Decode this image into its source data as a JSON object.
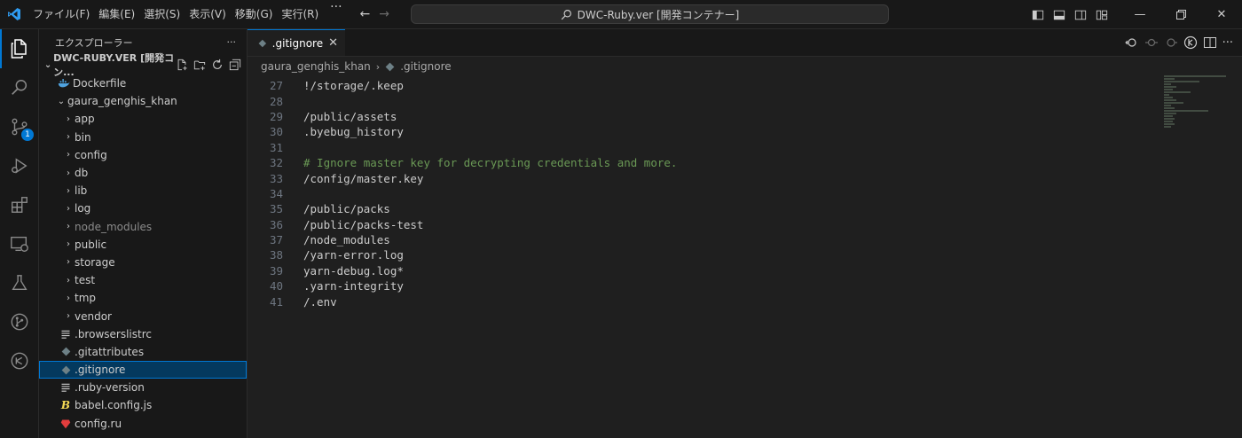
{
  "titlebar": {
    "menus": [
      "ファイル(F)",
      "編集(E)",
      "選択(S)",
      "表示(V)",
      "移動(G)",
      "実行(R)"
    ],
    "more": "···",
    "command_center": "DWC-Ruby.ver [開発コンテナー]"
  },
  "activitybar": {
    "scm_badge": "1",
    "items": [
      "explorer-icon",
      "search-icon",
      "source-control-icon",
      "run-debug-icon",
      "extensions-icon",
      "remote-explorer-icon",
      "testing-icon",
      "git-graph-icon",
      "docker-icon"
    ]
  },
  "sidebar": {
    "title": "エクスプローラー",
    "more": "···",
    "root": "DWC-RUBY.VER [開発コン...",
    "items": [
      {
        "label": "Dockerfile",
        "kind": "docker-file"
      },
      {
        "label": "gaura_genghis_khan",
        "kind": "folder-open"
      },
      {
        "label": "app",
        "kind": "folder"
      },
      {
        "label": "bin",
        "kind": "folder"
      },
      {
        "label": "config",
        "kind": "folder"
      },
      {
        "label": "db",
        "kind": "folder"
      },
      {
        "label": "lib",
        "kind": "folder"
      },
      {
        "label": "log",
        "kind": "folder"
      },
      {
        "label": "node_modules",
        "kind": "folder-dim"
      },
      {
        "label": "public",
        "kind": "folder"
      },
      {
        "label": "storage",
        "kind": "folder"
      },
      {
        "label": "test",
        "kind": "folder"
      },
      {
        "label": "tmp",
        "kind": "folder"
      },
      {
        "label": "vendor",
        "kind": "folder"
      },
      {
        "label": ".browserslistrc",
        "kind": "file-lines"
      },
      {
        "label": ".gitattributes",
        "kind": "git-file"
      },
      {
        "label": ".gitignore",
        "kind": "git-file"
      },
      {
        "label": ".ruby-version",
        "kind": "file-lines"
      },
      {
        "label": "babel.config.js",
        "kind": "babel-file"
      },
      {
        "label": "config.ru",
        "kind": "ruby-file"
      }
    ]
  },
  "editor": {
    "tab_label": ".gitignore",
    "breadcrumb": [
      "gaura_genghis_khan",
      ".gitignore"
    ],
    "lines": [
      {
        "n": "27",
        "text": "!/storage/.keep"
      },
      {
        "n": "28",
        "text": ""
      },
      {
        "n": "29",
        "text": "/public/assets"
      },
      {
        "n": "30",
        "text": ".byebug_history"
      },
      {
        "n": "31",
        "text": ""
      },
      {
        "n": "32",
        "text": "# Ignore master key for decrypting credentials and more.",
        "comment": true
      },
      {
        "n": "33",
        "text": "/config/master.key"
      },
      {
        "n": "34",
        "text": ""
      },
      {
        "n": "35",
        "text": "/public/packs"
      },
      {
        "n": "36",
        "text": "/public/packs-test"
      },
      {
        "n": "37",
        "text": "/node_modules"
      },
      {
        "n": "38",
        "text": "/yarn-error.log"
      },
      {
        "n": "39",
        "text": "yarn-debug.log*"
      },
      {
        "n": "40",
        "text": ".yarn-integrity"
      },
      {
        "n": "41",
        "text": "/.env"
      }
    ]
  },
  "colors": {
    "accent": "#0078d4",
    "selection": "#04395e",
    "comment": "#6a9955",
    "docker": "#4fa3e0",
    "babel": "#f5da55",
    "ruby": "#e23d3d"
  }
}
